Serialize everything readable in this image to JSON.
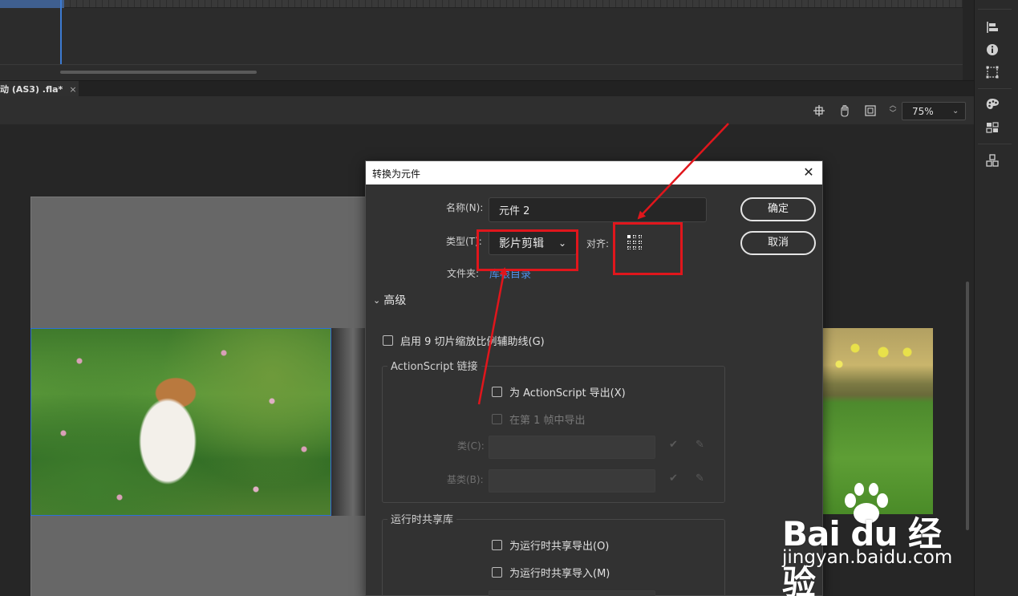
{
  "document_tab": {
    "label": "动 (AS3) .fla*",
    "close_glyph": "×"
  },
  "stage_toolbar": {
    "zoom_value": "75%"
  },
  "dialog": {
    "title": "转换为元件",
    "close_glyph": "✕",
    "name_label": "名称(N):",
    "name_value": "元件 2",
    "type_label": "类型(T):",
    "type_value": "影片剪辑",
    "align_label": "对齐:",
    "folder_label": "文件夹:",
    "folder_link": "库根目录",
    "ok_button": "确定",
    "cancel_button": "取消",
    "advanced_label": "高级",
    "nine_slice_label": "启用 9 切片缩放比例辅助线(G)",
    "actionscript_group": {
      "title": "ActionScript 链接",
      "export_for_as": "为 ActionScript 导出(X)",
      "export_in_frame1": "在第 1 帧中导出",
      "class_label": "类(C):",
      "base_class_label": "基类(B):"
    },
    "runtime_group": {
      "title": "运行时共享库",
      "export_runtime": "为运行时共享导出(O)",
      "import_runtime": "为运行时共享导入(M)"
    }
  },
  "watermark": {
    "logo": "Bai du 经验",
    "subtitle": "jingyan.baidu.com"
  },
  "colors": {
    "annotation_red": "#e0161c",
    "link_blue": "#4e8fe8",
    "selection_blue": "#2d6fd8"
  },
  "icons": {
    "panel": [
      "align-icon",
      "info-icon",
      "transform-icon",
      "color-palette-icon",
      "swatches-icon",
      "components-icon"
    ],
    "stage_toolbar": [
      "center-stage-icon",
      "hand-rotate-icon",
      "clip-stage-icon"
    ]
  }
}
